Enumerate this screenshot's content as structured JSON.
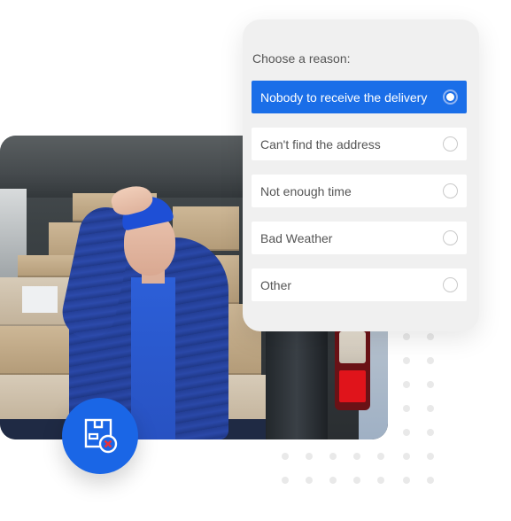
{
  "reason_card": {
    "title": "Choose a reason:",
    "options": [
      {
        "label": "Nobody to receive the delivery",
        "selected": true
      },
      {
        "label": "Can't find the address",
        "selected": false
      },
      {
        "label": "Not enough time",
        "selected": false
      },
      {
        "label": "Bad Weather",
        "selected": false
      },
      {
        "label": "Other",
        "selected": false
      }
    ]
  },
  "photo": {
    "description": "Tired delivery woman in blue cap and jacket sitting in van with cardboard boxes"
  },
  "badge": {
    "icon": "package-cancel-icon",
    "color": "#1a66e6",
    "accent": "#e8323c"
  },
  "colors": {
    "accent": "#1a6ee8",
    "card_bg": "#f0f0f0",
    "dot": "#e9e9e9"
  }
}
